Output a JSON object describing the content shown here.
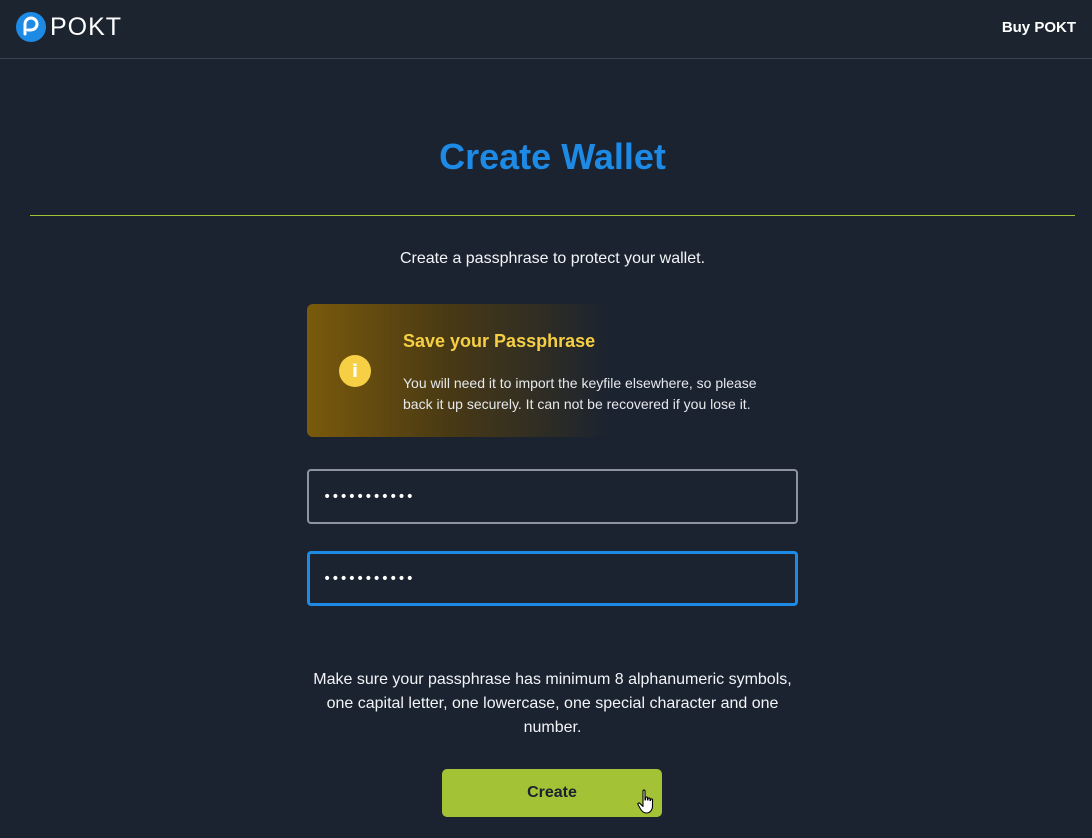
{
  "header": {
    "logo_text": "POKT",
    "buy_link": "Buy POKT"
  },
  "main": {
    "title": "Create Wallet",
    "subtitle": "Create a passphrase to protect your wallet.",
    "warning": {
      "icon": "info-icon",
      "icon_glyph": "i",
      "title": "Save your Passphrase",
      "body": "You will need it to import the keyfile elsewhere, so please back it up securely. It can not be recovered if you lose it."
    },
    "passphrase": {
      "value": "•••••••••••"
    },
    "confirm_passphrase": {
      "value": "•••••••••••"
    },
    "hint": "Make sure your passphrase has minimum 8 alphanumeric symbols, one capital letter, one lowercase, one special character and one number.",
    "create_label": "Create"
  },
  "colors": {
    "background": "#1b2330",
    "title_blue": "#1d8ae6",
    "accent_green": "#a3c236",
    "warning_yellow": "#f6cf44"
  }
}
